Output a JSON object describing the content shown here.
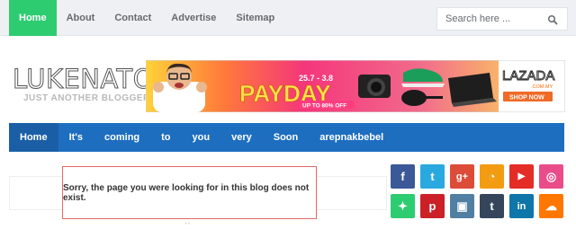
{
  "topnav": {
    "items": [
      {
        "label": "Home",
        "active": true
      },
      {
        "label": "About"
      },
      {
        "label": "Contact"
      },
      {
        "label": "Advertise"
      },
      {
        "label": "Sitemap"
      }
    ]
  },
  "search": {
    "placeholder": "Search here ..."
  },
  "logo": {
    "title": "LUKENATORS",
    "tagline": "JUST ANOTHER BLOGGER"
  },
  "banner": {
    "headline": "PAYDAY",
    "dates": "25.7 - 3.8",
    "offer": "UP TO 80% OFF",
    "brand": "LAZADA",
    "brand_domain": ".COM.MY",
    "cta": "SHOP NOW"
  },
  "mainnav": {
    "items": [
      {
        "label": "Home",
        "active": true
      },
      {
        "label": "It's"
      },
      {
        "label": "coming"
      },
      {
        "label": "to"
      },
      {
        "label": "you"
      },
      {
        "label": "very"
      },
      {
        "label": "Soon"
      },
      {
        "label": "arepnakbebel"
      }
    ]
  },
  "error": {
    "message": "Sorry, the page you were looking for in this blog does not exist."
  },
  "social": {
    "buttons": [
      {
        "name": "facebook-icon",
        "glyph": "f",
        "color": "#3b5998"
      },
      {
        "name": "twitter-icon",
        "glyph": "t",
        "color": "#29a9e0"
      },
      {
        "name": "google-plus-icon",
        "glyph": "g+",
        "color": "#dd4b39"
      },
      {
        "name": "rss-icon",
        "glyph": "◔",
        "color": "#f39c12"
      },
      {
        "name": "youtube-icon",
        "glyph": "▶",
        "color": "#e52d27"
      },
      {
        "name": "dribbble-icon",
        "glyph": "◎",
        "color": "#ea4c89"
      },
      {
        "name": "delicious-icon",
        "glyph": "✦",
        "color": "#2ecc71"
      },
      {
        "name": "pinterest-icon",
        "glyph": "p",
        "color": "#cb2027"
      },
      {
        "name": "instagram-icon",
        "glyph": "▣",
        "color": "#517fa4"
      },
      {
        "name": "tumblr-icon",
        "glyph": "t",
        "color": "#35465c"
      },
      {
        "name": "linkedin-icon",
        "glyph": "in",
        "color": "#0e76a8"
      },
      {
        "name": "soundcloud-icon",
        "glyph": "☁",
        "color": "#ff7700"
      }
    ]
  }
}
